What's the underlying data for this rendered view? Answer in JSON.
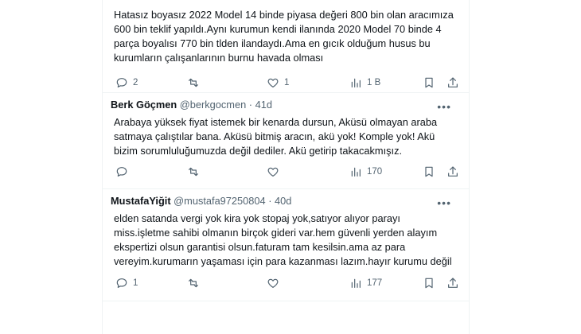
{
  "tweets": [
    {
      "text": "Hatasız boyasız 2022 Model 14 binde  piyasa değeri 800 bin olan aracımıza\n600 bin teklif yapıldı.Aynı kurumun kendi ilanında 2020 Model 70 binde 4\nparça boyalısı 770 bin tlden ilandaydı.Ama en gıcık olduğum husus bu\nkurumların çalışanlarının burnu havada olması",
      "replies": "2",
      "reposts": "",
      "likes": "1",
      "views": "1 B"
    },
    {
      "name": "Berk Göçmen",
      "handle": "@berkgocmen",
      "separator": "·",
      "time": "41d",
      "text": "Arabaya yüksek fiyat istemek bir kenarda dursun, Aküsü olmayan araba\nsatmaya çalıştılar bana. Aküsü bitmiş aracın, akü yok! Komple yok! Akü\nbizim sorumluluğumuzda değil dediler. Akü getirip takacakmışız.",
      "replies": "",
      "reposts": "",
      "likes": "",
      "views": "170"
    },
    {
      "name": "MustafaYiğit",
      "handle": "@mustafa97250804",
      "separator": "·",
      "time": "40d",
      "text": "elden satanda vergi yok kira yok stopaj yok,satıyor alıyor parayı\nmiss.işletme sahibi olmanın birçok gideri var.hem güvenli yerden alayım\nekspertizi olsun garantisi olsun.faturam tam kesilsin.ama az para\nvereyim.kurumarın yaşaması için para kazanması lazım.hayır kurumu değil",
      "replies": "1",
      "reposts": "",
      "likes": "",
      "views": "177"
    }
  ],
  "icons": {
    "more": "more-horizontal-icon",
    "reply": "reply-icon",
    "repost": "repost-icon",
    "like": "heart-icon",
    "views": "views-bar-chart-icon",
    "bookmark": "bookmark-icon",
    "share": "share-icon"
  },
  "colors": {
    "text": "#0f1419",
    "secondary": "#536471",
    "divider": "#eff3f4"
  }
}
